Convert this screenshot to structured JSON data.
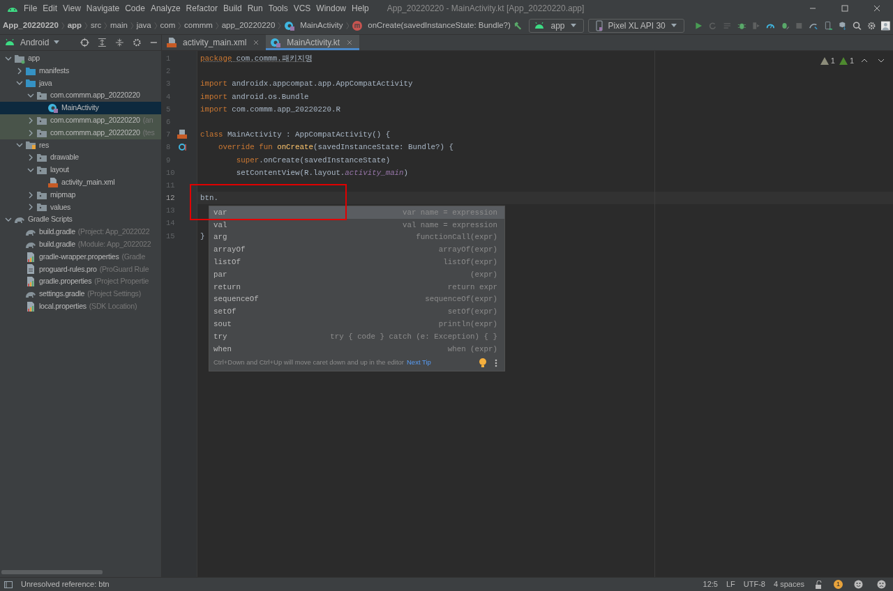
{
  "menu": [
    "File",
    "Edit",
    "View",
    "Navigate",
    "Code",
    "Analyze",
    "Refactor",
    "Build",
    "Run",
    "Tools",
    "VCS",
    "Window",
    "Help"
  ],
  "window": {
    "title": "App_20220220 - MainActivity.kt [App_20220220.app]"
  },
  "breadcrumbs": [
    {
      "label": "App_20220220",
      "kind": "bold"
    },
    {
      "label": "app",
      "kind": "bold"
    },
    {
      "label": "src",
      "kind": "plain"
    },
    {
      "label": "main",
      "kind": "plain"
    },
    {
      "label": "java",
      "kind": "plain"
    },
    {
      "label": "com",
      "kind": "plain"
    },
    {
      "label": "commm",
      "kind": "plain"
    },
    {
      "label": "app_20220220",
      "kind": "plain"
    },
    {
      "label": "MainActivity",
      "kind": "class"
    },
    {
      "label": "onCreate(savedInstanceState: Bundle?)",
      "kind": "method"
    }
  ],
  "run_config": "app",
  "device": "Pixel XL API 30",
  "project_view": "Android",
  "tabs": [
    {
      "label": "activity_main.xml",
      "kind": "xml",
      "selected": false
    },
    {
      "label": "MainActivity.kt",
      "kind": "kotlin",
      "selected": true
    }
  ],
  "tree": [
    {
      "label": "app",
      "kind": "module",
      "expanded": true,
      "selected": false,
      "highlighted": false,
      "children": [
        {
          "label": "manifests",
          "kind": "folder",
          "expanded": false,
          "selected": false,
          "highlighted": false
        },
        {
          "label": "java",
          "kind": "folder",
          "expanded": true,
          "selected": false,
          "highlighted": false,
          "children": [
            {
              "label": "com.commm.app_20220220",
              "kind": "package",
              "expanded": true,
              "selected": false,
              "highlighted": false,
              "children": [
                {
                  "label": "MainActivity",
                  "kind": "kotlin",
                  "selected": true,
                  "highlighted": false
                }
              ]
            },
            {
              "label": "com.commm.app_20220220",
              "note": "(an",
              "kind": "package",
              "expanded": false,
              "selected": false,
              "highlighted": true
            },
            {
              "label": "com.commm.app_20220220",
              "note": "(tes",
              "kind": "package",
              "expanded": false,
              "selected": false,
              "highlighted": true
            }
          ]
        },
        {
          "label": "res",
          "kind": "resfolder",
          "expanded": true,
          "selected": false,
          "highlighted": false,
          "children": [
            {
              "label": "drawable",
              "kind": "package",
              "expanded": false,
              "selected": false,
              "highlighted": false
            },
            {
              "label": "layout",
              "kind": "package",
              "expanded": true,
              "selected": false,
              "highlighted": false,
              "children": [
                {
                  "label": "activity_main.xml",
                  "kind": "xml",
                  "selected": false,
                  "highlighted": false
                }
              ]
            },
            {
              "label": "mipmap",
              "kind": "package",
              "expanded": false,
              "selected": false,
              "highlighted": false
            },
            {
              "label": "values",
              "kind": "package",
              "expanded": false,
              "selected": false,
              "highlighted": false
            }
          ]
        }
      ]
    },
    {
      "label": "Gradle Scripts",
      "kind": "gradle",
      "expanded": true,
      "selected": false,
      "highlighted": false,
      "children": [
        {
          "label": "build.gradle",
          "note": "(Project: App_2022022",
          "kind": "gradle",
          "selected": false,
          "highlighted": false
        },
        {
          "label": "build.gradle",
          "note": "(Module: App_2022022",
          "kind": "gradle",
          "selected": false,
          "highlighted": false
        },
        {
          "label": "gradle-wrapper.properties",
          "note": "(Gradle",
          "kind": "properties",
          "selected": false,
          "highlighted": false
        },
        {
          "label": "proguard-rules.pro",
          "note": "(ProGuard Rule",
          "kind": "file",
          "selected": false,
          "highlighted": false
        },
        {
          "label": "gradle.properties",
          "note": "(Project Propertie",
          "kind": "properties",
          "selected": false,
          "highlighted": false
        },
        {
          "label": "settings.gradle",
          "note": "(Project Settings)",
          "kind": "gradle",
          "selected": false,
          "highlighted": false
        },
        {
          "label": "local.properties",
          "note": "(SDK Location)",
          "kind": "properties",
          "selected": false,
          "highlighted": false
        }
      ]
    }
  ],
  "inspections": [
    {
      "count": "1",
      "kind": "warning"
    },
    {
      "count": "1",
      "kind": "weak"
    }
  ],
  "code": [
    {
      "number": "1",
      "current": false,
      "tokens": [
        {
          "text": "package",
          "kind": "keyword-underlined"
        },
        {
          "text": " com.commm.패키지명",
          "kind": "underlined"
        }
      ]
    },
    {
      "number": "2",
      "current": false
    },
    {
      "number": "3",
      "current": false,
      "tokens": [
        {
          "text": "import",
          "kind": "keyword"
        },
        {
          "text": " androidx.appcompat.app.AppCompatActivity",
          "kind": "plain"
        }
      ]
    },
    {
      "number": "4",
      "current": false,
      "tokens": [
        {
          "text": "import",
          "kind": "keyword"
        },
        {
          "text": " android.os.Bundle",
          "kind": "plain"
        }
      ]
    },
    {
      "number": "5",
      "current": false,
      "tokens": [
        {
          "text": "import",
          "kind": "keyword"
        },
        {
          "text": " com.commm.app_20220220.R",
          "kind": "plain"
        }
      ]
    },
    {
      "number": "6",
      "current": false
    },
    {
      "number": "7",
      "current": false,
      "tokens": [
        {
          "text": "class",
          "kind": "keyword"
        },
        {
          "text": " MainActivity : AppCompatActivity() {",
          "kind": "plain"
        }
      ]
    },
    {
      "number": "8",
      "current": false,
      "tokens": [
        {
          "text": "    override fun ",
          "kind": "keyword"
        },
        {
          "text": "onCreate",
          "kind": "function"
        },
        {
          "text": "(savedInstanceState: Bundle?) {",
          "kind": "plain"
        }
      ]
    },
    {
      "number": "9",
      "current": false,
      "tokens": [
        {
          "text": "        super",
          "kind": "keyword"
        },
        {
          "text": ".onCreate(savedInstanceState)",
          "kind": "plain"
        }
      ]
    },
    {
      "number": "10",
      "current": false,
      "tokens": [
        {
          "text": "        setContentView(R.layout.",
          "kind": "plain"
        },
        {
          "text": "activity_main",
          "kind": "property"
        },
        {
          "text": ")",
          "kind": "plain"
        }
      ]
    },
    {
      "number": "11",
      "current": false
    },
    {
      "number": "12",
      "current": true,
      "tokens": [
        {
          "text": "btn.",
          "kind": "plain"
        }
      ]
    },
    {
      "number": "13",
      "current": false
    },
    {
      "number": "14",
      "current": false
    },
    {
      "number": "15",
      "current": false,
      "tokens": [
        {
          "text": "}",
          "kind": "plain"
        }
      ]
    }
  ],
  "completion": {
    "items": [
      {
        "label": "var",
        "hint": "var name = expression",
        "selected": true
      },
      {
        "label": "val",
        "hint": "val name = expression",
        "selected": false
      },
      {
        "label": "arg",
        "hint": "functionCall(expr)",
        "selected": false
      },
      {
        "label": "arrayOf",
        "hint": "arrayOf(expr)",
        "selected": false
      },
      {
        "label": "listOf",
        "hint": "listOf(expr)",
        "selected": false
      },
      {
        "label": "par",
        "hint": "(expr)",
        "selected": false
      },
      {
        "label": "return",
        "hint": "return expr",
        "selected": false
      },
      {
        "label": "sequenceOf",
        "hint": "sequenceOf(expr)",
        "selected": false
      },
      {
        "label": "setOf",
        "hint": "setOf(expr)",
        "selected": false
      },
      {
        "label": "sout",
        "hint": "println(expr)",
        "selected": false
      },
      {
        "label": "try",
        "hint": "try { code } catch (e: Exception) { }",
        "selected": false
      },
      {
        "label": "when",
        "hint": "when (expr)",
        "selected": false
      }
    ],
    "tip": "Ctrl+Down and Ctrl+Up will move caret down and up in the editor",
    "tip_link": "Next Tip"
  },
  "status_bar": {
    "message": "Unresolved reference: btn",
    "position": "12:5",
    "line_sep": "LF",
    "encoding": "UTF-8",
    "indent": "4 spaces",
    "notifications": "1"
  }
}
